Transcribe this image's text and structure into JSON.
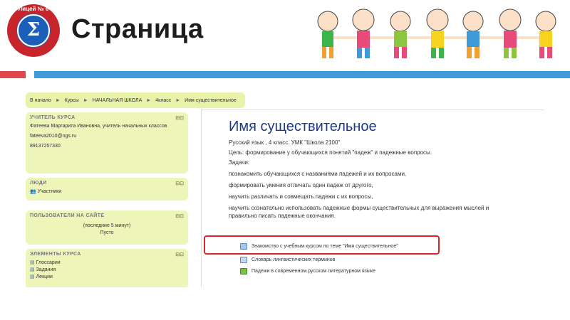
{
  "slide": {
    "title": "Страница",
    "logo_text": "Лицей № 6",
    "logo_symbol": "Σ"
  },
  "colors": {
    "accent_red": "#e0474b",
    "accent_blue": "#3f9bd8",
    "block_bg": "#eef5b9",
    "highlight": "#d9262b",
    "title_blue": "#1e3a8a"
  },
  "breadcrumb": [
    "В начало",
    "Курсы",
    "НАЧАЛЬНАЯ ШКОЛА",
    "4класс",
    "Имя существительное"
  ],
  "sidebar": {
    "teacher": {
      "title": "УЧИТЕЛЬ КУРСА",
      "name": "Фатеева Маргарита Ивановна, учитель начальных классов",
      "email": "fateeva2010@ngs.ru",
      "phone": "89137257330"
    },
    "people": {
      "title": "ЛЮДИ",
      "item": "Участники"
    },
    "online": {
      "title": "ПОЛЬЗОВАТЕЛИ НА САЙТЕ",
      "period": "(последние 5 минут)",
      "status": "Пусто"
    },
    "elements": {
      "title": "ЭЛЕМЕНТЫ КУРСА",
      "items": [
        "Глоссарии",
        "Задания",
        "Лекции"
      ]
    }
  },
  "main": {
    "title": "Имя существительное",
    "subtitle": "Русский язык , 4 класс. УМК \"Школа 2100\"",
    "goal": "Цель: формирование у обучающихся понятий \"падеж\" и падежные вопросы.",
    "tasks_label": "Задачи:",
    "tasks": [
      "познакомить обучающихся с названиями падежей и их вопросами,",
      "формировать  умения отличать один падеж от другого,",
      "научить различать и совмещать падежи с их вопросы,",
      "научить сознательно использовать падежные формы существительных для выражения мыслей и правильно писать падежные окончания."
    ],
    "links": [
      "Знакомство с учебным курсом по теме \"Имя существительное\"",
      "Словарь лингвистических терминов",
      "Падежи в современном русском литературном языке"
    ]
  }
}
